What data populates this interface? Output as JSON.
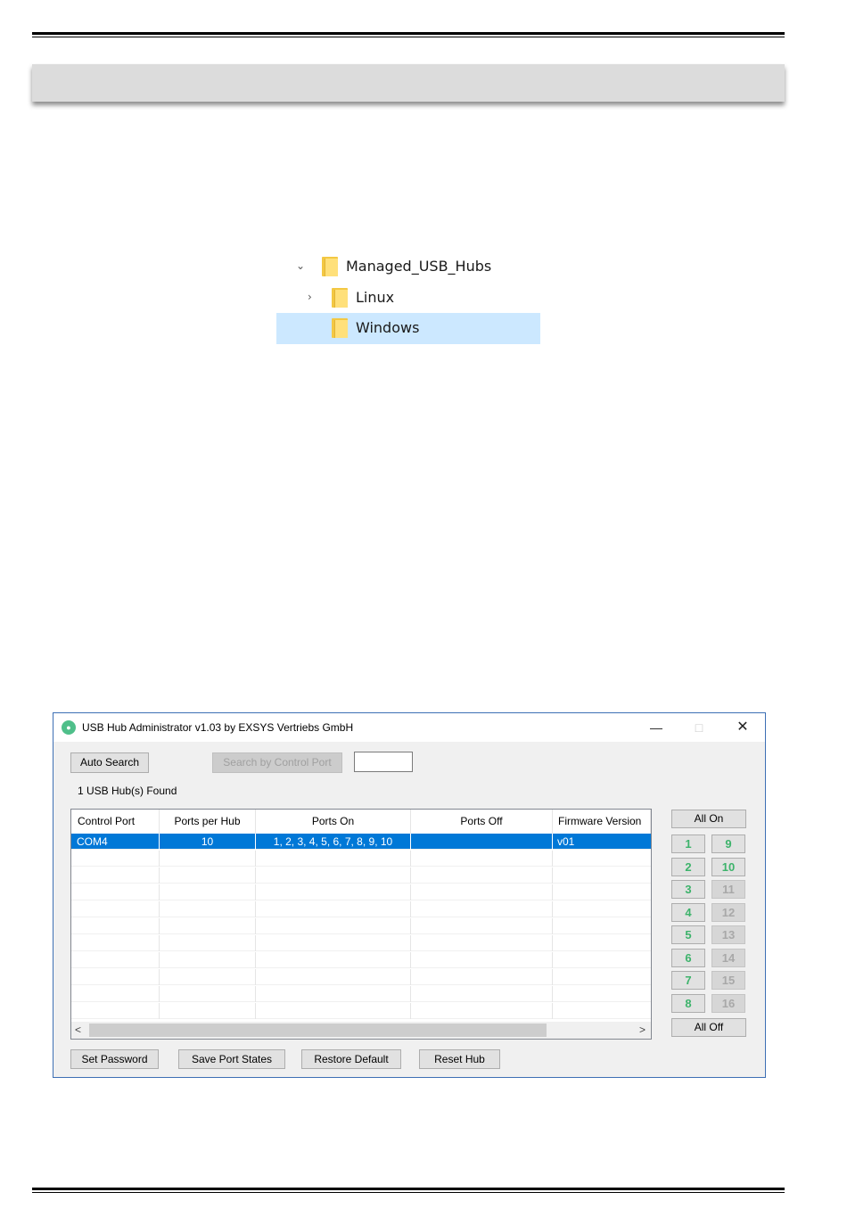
{
  "folder_tree": {
    "items": [
      {
        "label": "Managed_USB_Hubs",
        "arrow": "expanded",
        "selected": false
      },
      {
        "label": "Linux",
        "arrow": "collapsed",
        "selected": false
      },
      {
        "label": "Windows",
        "arrow": "none",
        "selected": true
      }
    ]
  },
  "app": {
    "title": "USB Hub Administrator v1.03 by EXSYS Vertriebs GmbH",
    "icon": "usb-app-icon",
    "window_controls": {
      "minimize": "—",
      "maximize": "□",
      "close": "✕"
    },
    "auto_search_label": "Auto Search",
    "search_by_port_label": "Search by Control Port",
    "control_port_value": "",
    "hubs_found": "1 USB Hub(s) Found",
    "table": {
      "columns": [
        "Control Port",
        "Ports per Hub",
        "Ports On",
        "Ports Off",
        "Firmware Version"
      ],
      "rows": [
        {
          "control_port": "COM4",
          "ports_per_hub": "10",
          "ports_on": "1, 2, 3, 4, 5, 6, 7, 8, 9, 10",
          "ports_off": "",
          "firmware": "v01",
          "selected": true
        }
      ],
      "scroll_left": "<",
      "scroll_right": ">"
    },
    "all_on_label": "All On",
    "all_off_label": "All Off",
    "ports": [
      {
        "label": "1",
        "state": "on"
      },
      {
        "label": "9",
        "state": "on"
      },
      {
        "label": "2",
        "state": "on"
      },
      {
        "label": "10",
        "state": "on"
      },
      {
        "label": "3",
        "state": "on"
      },
      {
        "label": "11",
        "state": "off"
      },
      {
        "label": "4",
        "state": "on"
      },
      {
        "label": "12",
        "state": "off"
      },
      {
        "label": "5",
        "state": "on"
      },
      {
        "label": "13",
        "state": "off"
      },
      {
        "label": "6",
        "state": "on"
      },
      {
        "label": "14",
        "state": "off"
      },
      {
        "label": "7",
        "state": "on"
      },
      {
        "label": "15",
        "state": "off"
      },
      {
        "label": "8",
        "state": "on"
      },
      {
        "label": "16",
        "state": "off"
      }
    ],
    "bottom_buttons": {
      "set_password": "Set Password",
      "save_port_states": "Save Port States",
      "restore_default": "Restore Default",
      "reset_hub": "Reset Hub"
    },
    "colors": {
      "port_on": "#3db36b",
      "port_off": "#a8a8a8",
      "selection": "#0078d7",
      "tree_selection": "#cce8ff"
    }
  }
}
